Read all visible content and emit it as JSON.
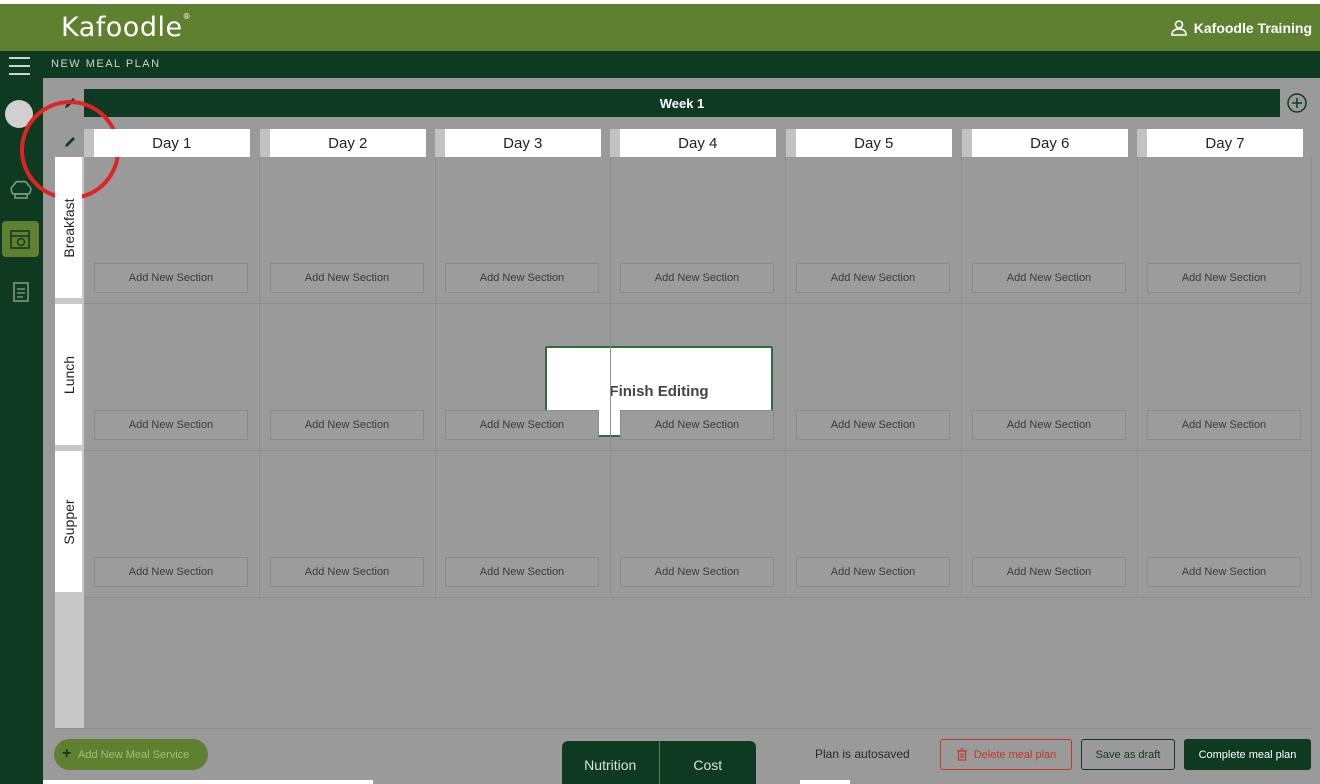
{
  "header": {
    "logo": "Kafoodle",
    "user_name": "Kafoodle Training"
  },
  "subheader": {
    "title": "NEW MEAL PLAN"
  },
  "week": {
    "label": "Week 1"
  },
  "days": [
    "Day 1",
    "Day 2",
    "Day 3",
    "Day 4",
    "Day 5",
    "Day 6",
    "Day 7"
  ],
  "meal_services": [
    "Breakfast",
    "Lunch",
    "Supper"
  ],
  "cell_button_label": "Add New Section",
  "modal": {
    "label": "Finish Editing"
  },
  "footer": {
    "add_meal_service": "Add New Meal Service",
    "tabs": [
      "Nutrition",
      "Cost"
    ],
    "autosave": "Plan is autosaved",
    "delete": "Delete meal plan",
    "draft": "Save as draft",
    "complete": "Complete meal plan"
  },
  "colors": {
    "brand_green": "#5f8030",
    "dark_green": "#0f3a22",
    "danger": "#c0392b",
    "highlight_circle": "#e02424"
  },
  "icons": [
    "menu-icon",
    "user-icon",
    "chef-hat-icon",
    "calendar-icon",
    "clipboard-icon",
    "pencil-icon",
    "plus-circle-icon",
    "trash-icon",
    "plus-icon"
  ]
}
